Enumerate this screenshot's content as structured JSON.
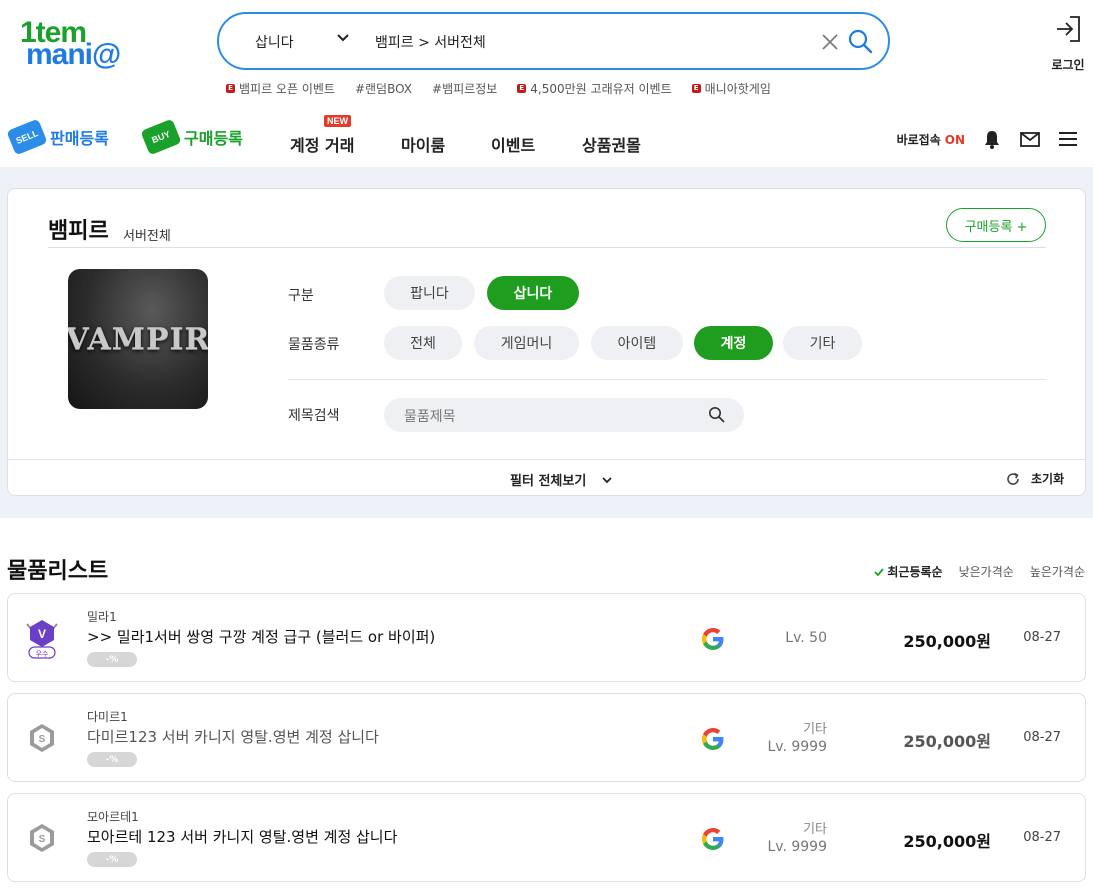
{
  "header": {
    "logo_line1": "1tem",
    "logo_line2": "mani@",
    "search_type": "삽니다",
    "search_query": "뱀피르 > 서버전체",
    "hot_links": [
      {
        "label": "뱀피르 오픈 이벤트",
        "badge": true
      },
      {
        "label": "#랜덤BOX",
        "badge": false
      },
      {
        "label": "#뱀피르정보",
        "badge": false
      },
      {
        "label": "4,500만원 고래유저 이벤트",
        "badge": true
      },
      {
        "label": "매니아핫게임",
        "badge": true
      }
    ],
    "login_label": "로그인"
  },
  "nav": {
    "sell_tag": "SELL",
    "sell_label": "판매등록",
    "buy_tag": "BUY",
    "buy_label": "구매등록",
    "account_trade": "계정 거래",
    "new_badge": "NEW",
    "myroom": "마이룸",
    "event": "이벤트",
    "giftcard": "상품권몰",
    "quick_label": "바로접속",
    "quick_state": "ON"
  },
  "filter": {
    "game_name": "뱀피르",
    "server_label": "서버전체",
    "buy_register": "구매등록 +",
    "thumb_text": "VAMPIR",
    "type_label": "구분",
    "type_options": [
      {
        "label": "팝니다",
        "active": false
      },
      {
        "label": "삽니다",
        "active": true
      }
    ],
    "category_label": "물품종류",
    "category_options": [
      {
        "label": "전체",
        "active": false
      },
      {
        "label": "게임머니",
        "active": false
      },
      {
        "label": "아이템",
        "active": false
      },
      {
        "label": "계정",
        "active": true
      },
      {
        "label": "기타",
        "active": false
      }
    ],
    "title_search_label": "제목검색",
    "title_search_placeholder": "물품제목",
    "view_all_filters": "필터 전체보기",
    "reset": "초기화"
  },
  "list": {
    "title": "물품리스트",
    "sorts": [
      {
        "label": "최근등록순",
        "active": true
      },
      {
        "label": "낮은가격순",
        "active": false
      },
      {
        "label": "높은가격순",
        "active": false
      }
    ],
    "items": [
      {
        "server": "밀라1",
        "title": ">> 밀라1서버 쌍영 구깡 계정 급구 (블러드 or 바이퍼)",
        "percent": "-%",
        "badge": "v-excellent",
        "badge_letter": "V",
        "badge_text": "우수",
        "category": "",
        "level": "Lv. 50",
        "price": "250,000원",
        "date": "08-27",
        "dim": false
      },
      {
        "server": "다미르1",
        "title": "다미르123 서버 카니지 영탈.영변 계정 삽니다",
        "percent": "-%",
        "badge": "silver",
        "badge_letter": "S",
        "badge_text": "",
        "category": "기타",
        "level": "Lv. 9999",
        "price": "250,000원",
        "date": "08-27",
        "dim": true
      },
      {
        "server": "모아르테1",
        "title": "모아르테 123 서버 카니지 영탈.영변 계정 삽니다",
        "percent": "-%",
        "badge": "silver",
        "badge_letter": "S",
        "badge_text": "",
        "category": "기타",
        "level": "Lv. 9999",
        "price": "250,000원",
        "date": "08-27",
        "dim": false
      }
    ]
  },
  "colors": {
    "brand_green": "#1aa12b",
    "brand_blue": "#1e7be0",
    "active_chip": "#1e9d1e",
    "search_border": "#2b8de8",
    "on_red": "#e33b2a"
  }
}
